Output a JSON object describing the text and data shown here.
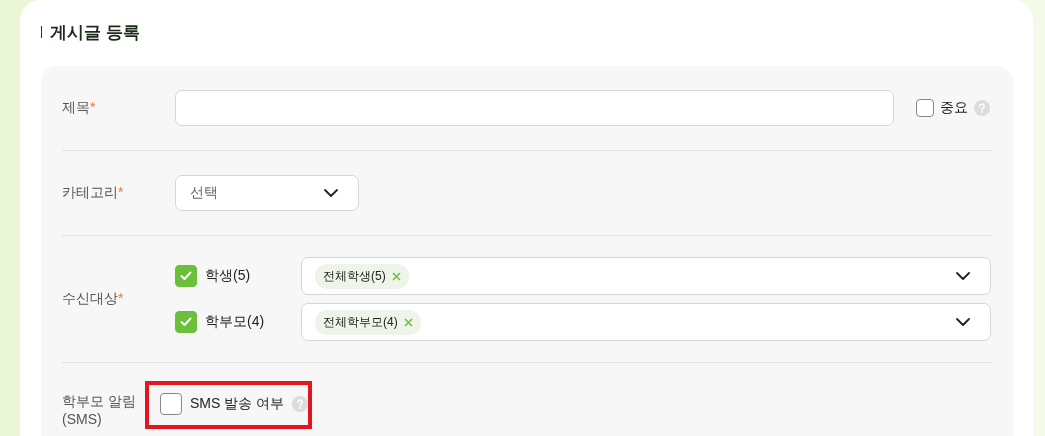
{
  "title": "게시글 등록",
  "subject": {
    "label": "제목",
    "required_mark": "*",
    "important": {
      "label": "중요",
      "checked": false
    }
  },
  "category": {
    "label": "카테고리",
    "required_mark": "*",
    "placeholder": "선택"
  },
  "recipients": {
    "label": "수신대상",
    "required_mark": "*",
    "groups": [
      {
        "label": "학생(5)",
        "checked": true,
        "tags": [
          "전체학생(5)"
        ]
      },
      {
        "label": "학부모(4)",
        "checked": true,
        "tags": [
          "전체학부모(4)"
        ]
      }
    ]
  },
  "sms": {
    "label": "학부모 알림 (SMS)",
    "highlighted": true,
    "option": {
      "label": "SMS 발송 여부",
      "checked": false
    }
  }
}
